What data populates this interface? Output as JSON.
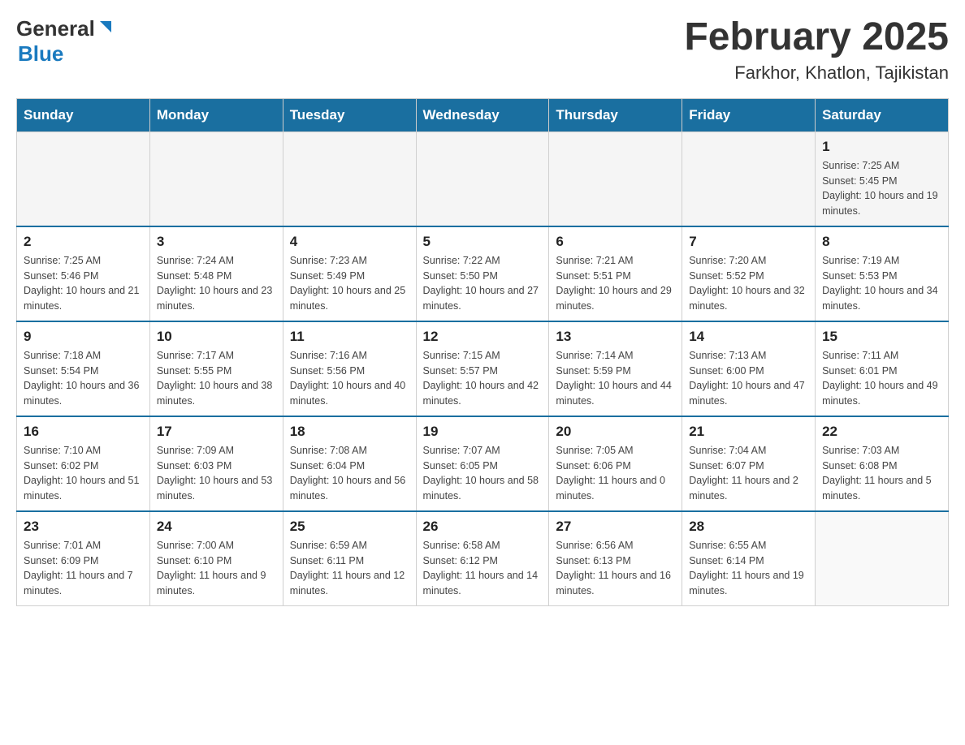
{
  "header": {
    "logo_general": "General",
    "logo_blue": "Blue",
    "title": "February 2025",
    "subtitle": "Farkhor, Khatlon, Tajikistan"
  },
  "weekdays": [
    "Sunday",
    "Monday",
    "Tuesday",
    "Wednesday",
    "Thursday",
    "Friday",
    "Saturday"
  ],
  "weeks": [
    [
      {
        "day": "",
        "sunrise": "",
        "sunset": "",
        "daylight": ""
      },
      {
        "day": "",
        "sunrise": "",
        "sunset": "",
        "daylight": ""
      },
      {
        "day": "",
        "sunrise": "",
        "sunset": "",
        "daylight": ""
      },
      {
        "day": "",
        "sunrise": "",
        "sunset": "",
        "daylight": ""
      },
      {
        "day": "",
        "sunrise": "",
        "sunset": "",
        "daylight": ""
      },
      {
        "day": "",
        "sunrise": "",
        "sunset": "",
        "daylight": ""
      },
      {
        "day": "1",
        "sunrise": "Sunrise: 7:25 AM",
        "sunset": "Sunset: 5:45 PM",
        "daylight": "Daylight: 10 hours and 19 minutes."
      }
    ],
    [
      {
        "day": "2",
        "sunrise": "Sunrise: 7:25 AM",
        "sunset": "Sunset: 5:46 PM",
        "daylight": "Daylight: 10 hours and 21 minutes."
      },
      {
        "day": "3",
        "sunrise": "Sunrise: 7:24 AM",
        "sunset": "Sunset: 5:48 PM",
        "daylight": "Daylight: 10 hours and 23 minutes."
      },
      {
        "day": "4",
        "sunrise": "Sunrise: 7:23 AM",
        "sunset": "Sunset: 5:49 PM",
        "daylight": "Daylight: 10 hours and 25 minutes."
      },
      {
        "day": "5",
        "sunrise": "Sunrise: 7:22 AM",
        "sunset": "Sunset: 5:50 PM",
        "daylight": "Daylight: 10 hours and 27 minutes."
      },
      {
        "day": "6",
        "sunrise": "Sunrise: 7:21 AM",
        "sunset": "Sunset: 5:51 PM",
        "daylight": "Daylight: 10 hours and 29 minutes."
      },
      {
        "day": "7",
        "sunrise": "Sunrise: 7:20 AM",
        "sunset": "Sunset: 5:52 PM",
        "daylight": "Daylight: 10 hours and 32 minutes."
      },
      {
        "day": "8",
        "sunrise": "Sunrise: 7:19 AM",
        "sunset": "Sunset: 5:53 PM",
        "daylight": "Daylight: 10 hours and 34 minutes."
      }
    ],
    [
      {
        "day": "9",
        "sunrise": "Sunrise: 7:18 AM",
        "sunset": "Sunset: 5:54 PM",
        "daylight": "Daylight: 10 hours and 36 minutes."
      },
      {
        "day": "10",
        "sunrise": "Sunrise: 7:17 AM",
        "sunset": "Sunset: 5:55 PM",
        "daylight": "Daylight: 10 hours and 38 minutes."
      },
      {
        "day": "11",
        "sunrise": "Sunrise: 7:16 AM",
        "sunset": "Sunset: 5:56 PM",
        "daylight": "Daylight: 10 hours and 40 minutes."
      },
      {
        "day": "12",
        "sunrise": "Sunrise: 7:15 AM",
        "sunset": "Sunset: 5:57 PM",
        "daylight": "Daylight: 10 hours and 42 minutes."
      },
      {
        "day": "13",
        "sunrise": "Sunrise: 7:14 AM",
        "sunset": "Sunset: 5:59 PM",
        "daylight": "Daylight: 10 hours and 44 minutes."
      },
      {
        "day": "14",
        "sunrise": "Sunrise: 7:13 AM",
        "sunset": "Sunset: 6:00 PM",
        "daylight": "Daylight: 10 hours and 47 minutes."
      },
      {
        "day": "15",
        "sunrise": "Sunrise: 7:11 AM",
        "sunset": "Sunset: 6:01 PM",
        "daylight": "Daylight: 10 hours and 49 minutes."
      }
    ],
    [
      {
        "day": "16",
        "sunrise": "Sunrise: 7:10 AM",
        "sunset": "Sunset: 6:02 PM",
        "daylight": "Daylight: 10 hours and 51 minutes."
      },
      {
        "day": "17",
        "sunrise": "Sunrise: 7:09 AM",
        "sunset": "Sunset: 6:03 PM",
        "daylight": "Daylight: 10 hours and 53 minutes."
      },
      {
        "day": "18",
        "sunrise": "Sunrise: 7:08 AM",
        "sunset": "Sunset: 6:04 PM",
        "daylight": "Daylight: 10 hours and 56 minutes."
      },
      {
        "day": "19",
        "sunrise": "Sunrise: 7:07 AM",
        "sunset": "Sunset: 6:05 PM",
        "daylight": "Daylight: 10 hours and 58 minutes."
      },
      {
        "day": "20",
        "sunrise": "Sunrise: 7:05 AM",
        "sunset": "Sunset: 6:06 PM",
        "daylight": "Daylight: 11 hours and 0 minutes."
      },
      {
        "day": "21",
        "sunrise": "Sunrise: 7:04 AM",
        "sunset": "Sunset: 6:07 PM",
        "daylight": "Daylight: 11 hours and 2 minutes."
      },
      {
        "day": "22",
        "sunrise": "Sunrise: 7:03 AM",
        "sunset": "Sunset: 6:08 PM",
        "daylight": "Daylight: 11 hours and 5 minutes."
      }
    ],
    [
      {
        "day": "23",
        "sunrise": "Sunrise: 7:01 AM",
        "sunset": "Sunset: 6:09 PM",
        "daylight": "Daylight: 11 hours and 7 minutes."
      },
      {
        "day": "24",
        "sunrise": "Sunrise: 7:00 AM",
        "sunset": "Sunset: 6:10 PM",
        "daylight": "Daylight: 11 hours and 9 minutes."
      },
      {
        "day": "25",
        "sunrise": "Sunrise: 6:59 AM",
        "sunset": "Sunset: 6:11 PM",
        "daylight": "Daylight: 11 hours and 12 minutes."
      },
      {
        "day": "26",
        "sunrise": "Sunrise: 6:58 AM",
        "sunset": "Sunset: 6:12 PM",
        "daylight": "Daylight: 11 hours and 14 minutes."
      },
      {
        "day": "27",
        "sunrise": "Sunrise: 6:56 AM",
        "sunset": "Sunset: 6:13 PM",
        "daylight": "Daylight: 11 hours and 16 minutes."
      },
      {
        "day": "28",
        "sunrise": "Sunrise: 6:55 AM",
        "sunset": "Sunset: 6:14 PM",
        "daylight": "Daylight: 11 hours and 19 minutes."
      },
      {
        "day": "",
        "sunrise": "",
        "sunset": "",
        "daylight": ""
      }
    ]
  ]
}
